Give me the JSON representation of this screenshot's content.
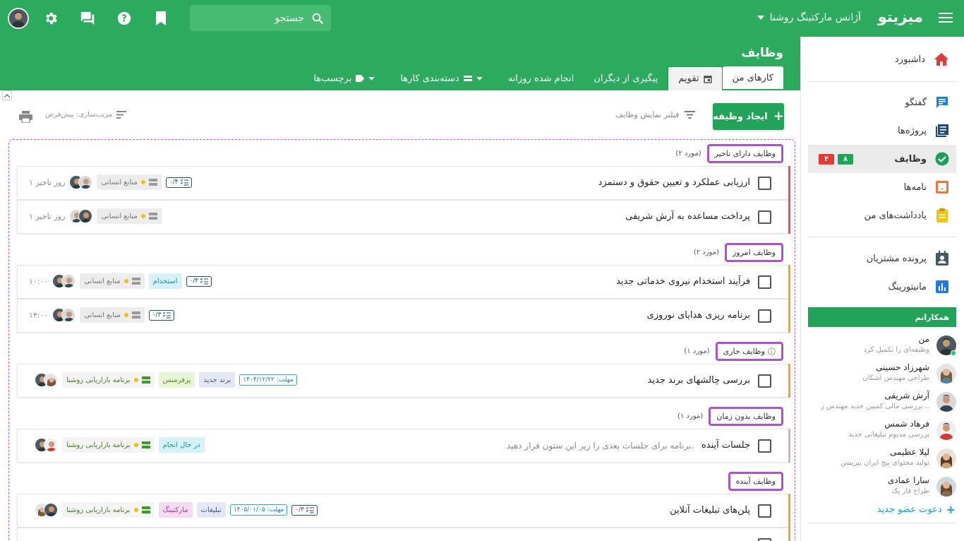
{
  "app": {
    "brand": "میزیتو",
    "org": "آژانس مارکتینگ روشنا",
    "search_placeholder": "جستجو"
  },
  "page": {
    "title": "وظایف"
  },
  "tabs": [
    {
      "label": "کارهای من"
    },
    {
      "label": "تقویم"
    },
    {
      "label": "پیگیری از دیگران"
    },
    {
      "label": "انجام شده روزانه"
    },
    {
      "label": "دسته‌بندی کارها"
    },
    {
      "label": "برچسب‌ها"
    }
  ],
  "toolbar": {
    "create": "ایجاد وظیفه",
    "filter": "فیلتر نمایش وظایف",
    "sort": "مرتب‌سازی: پیش‌فرض"
  },
  "sidebar": {
    "nav": [
      {
        "label": "داشبورد"
      },
      {
        "label": "گفتگو"
      },
      {
        "label": "پروژه‌ها"
      },
      {
        "label": "وظایف",
        "badge_green": "۸",
        "badge_red": "۴"
      },
      {
        "label": "نامه‌ها"
      },
      {
        "label": "یادداشت‌های من"
      },
      {
        "label": "پرونده مشتریان"
      },
      {
        "label": "مانیتورینگ"
      }
    ],
    "colleagues_title": "همکارانم",
    "colleagues": [
      {
        "name": "من",
        "sub": "وظیفه‌ای را تکمیل کرد"
      },
      {
        "name": "شهرزاد حسینی",
        "sub": "طراحی مهندس اشکان"
      },
      {
        "name": "آرش شریفی",
        "sub": "بررسی مالی کمپین جدید مهندس ز..."
      },
      {
        "name": "فرهاد شمس",
        "sub": "بررسی مدیوم تبلیغاتی جدید"
      },
      {
        "name": "لیلا عظیمی",
        "sub": "تولید محتوای پیج ایران بیزینس"
      },
      {
        "name": "سارا عمادی",
        "sub": "طراح فاز یک"
      }
    ],
    "invite": "دعوت عضو جدید"
  },
  "groups": [
    {
      "title": "وظایف دارای تاخیر",
      "count": "(۲ مورد)"
    },
    {
      "title": "وظایف امروز",
      "count": "(۲ مورد)"
    },
    {
      "title": "وظایف جاری",
      "count": "(۱ مورد)"
    },
    {
      "title": "وظایف بدون زمان",
      "count": "(۱ مورد)"
    },
    {
      "title": "وظایف آینده",
      "count": ""
    }
  ],
  "tasks": [
    {
      "title": "ارزیابی عملکرد و تعیین حقوق و دستمزد",
      "progress": "۰/۴",
      "project": "منابع انسانی",
      "late": "۱ روز تاخیر"
    },
    {
      "title": "پرداخت مساعده به آرش شریفی",
      "project": "منابع انسانی",
      "late": "۱ روز تاخیر"
    },
    {
      "title": "فرآیند استخدام نیروی خدماتی جدید",
      "progress": "۰/۴",
      "tag": "استخدام",
      "project": "منابع انسانی",
      "time": "۱۰:۰۰"
    },
    {
      "title": "برنامه ریزی هدایای نوروزی",
      "progress": "۰/۳",
      "project": "منابع انسانی",
      "time": "۱۴:۰۰"
    },
    {
      "title": "بررسی چالشهای برند جدید",
      "due": "مهلت: ۱۴۰۴/۱۲/۲۲",
      "tag1": "برند جدید",
      "tag2": "پرفرمنس",
      "project": "برنامه بازاریابی روشنا"
    },
    {
      "title": "جلسات آینده",
      "desc": "برنامه برای جلسات بعدی را زیر این ستون قرار دهید.",
      "tag": "در حال انجام",
      "project": "برنامه بازاریابی روشنا"
    },
    {
      "title": "پلن‌های تبلیغات آنلاین",
      "progress": "۰/۳",
      "due": "مهلت: ۱۴۰۵/۰۱/۰۵",
      "tag1": "تبلیغات",
      "tag2": "مارکتینگ",
      "project": "برنامه بازاریابی روشنا"
    }
  ],
  "colors": {
    "primary": "#2cab5e",
    "overdue": "#e0575b",
    "today": "#f5a623",
    "group_border": "#a855c5",
    "badge_red": "#e53935",
    "badge_green": "#22a35a"
  }
}
